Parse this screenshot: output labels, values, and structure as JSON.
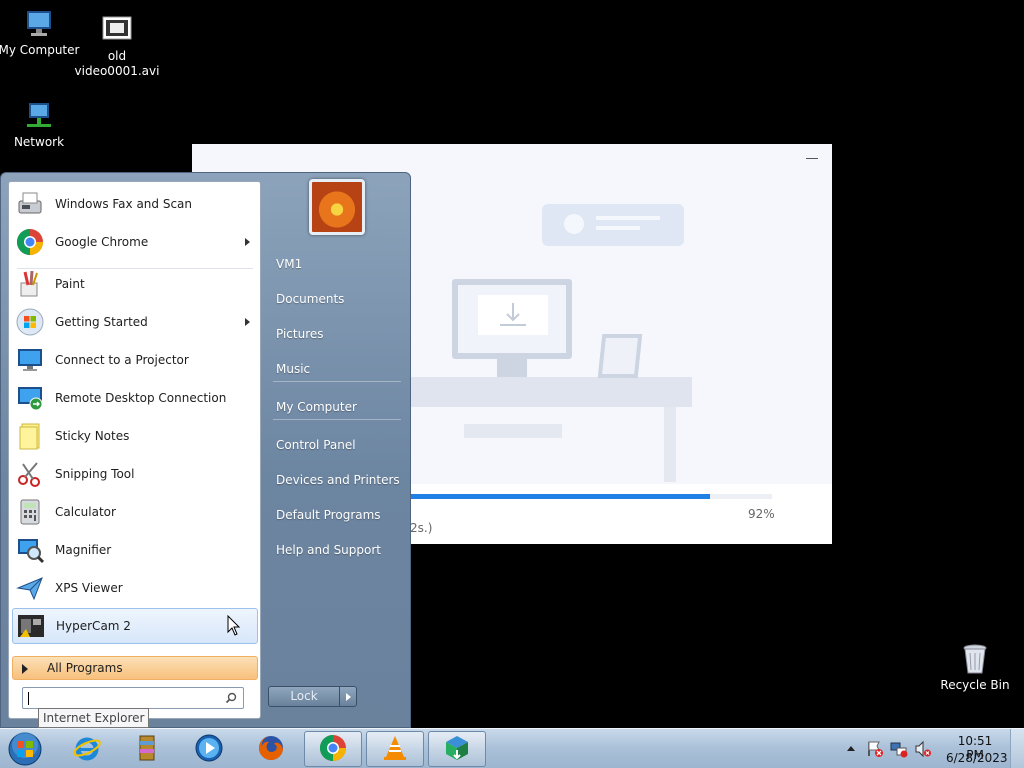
{
  "desktop": {
    "icons": [
      {
        "label": "My Computer"
      },
      {
        "label": "old video0001.avi"
      },
      {
        "label": "Network"
      },
      {
        "label": "Recycle Bin"
      }
    ]
  },
  "installer": {
    "progress_percent": 92,
    "progress_label": "92%",
    "time_label": "2s.)"
  },
  "start_menu": {
    "programs": [
      {
        "label": "Windows Fax and Scan",
        "icon": "fax-scanner-icon",
        "submenu": false
      },
      {
        "label": "Google Chrome",
        "icon": "chrome-icon",
        "submenu": true
      },
      {
        "label": "Paint",
        "icon": "paint-icon",
        "submenu": false
      },
      {
        "label": "Getting Started",
        "icon": "windows-logo-icon",
        "submenu": true
      },
      {
        "label": "Connect to a Projector",
        "icon": "projector-monitor-icon",
        "submenu": false
      },
      {
        "label": "Remote Desktop Connection",
        "icon": "remote-desktop-icon",
        "submenu": false
      },
      {
        "label": "Sticky Notes",
        "icon": "sticky-note-icon",
        "submenu": false
      },
      {
        "label": "Snipping Tool",
        "icon": "scissors-icon",
        "submenu": false
      },
      {
        "label": "Calculator",
        "icon": "calculator-icon",
        "submenu": false
      },
      {
        "label": "Magnifier",
        "icon": "magnifier-icon",
        "submenu": false
      },
      {
        "label": "XPS Viewer",
        "icon": "xps-plane-icon",
        "submenu": false
      },
      {
        "label": "HyperCam 2",
        "icon": "film-camera-icon",
        "submenu": false
      }
    ],
    "all_programs": "All Programs",
    "search_placeholder": "",
    "tooltip": "Internet Explorer",
    "right_items": [
      "VM1",
      "Documents",
      "Pictures",
      "Music",
      "My Computer",
      "Control Panel",
      "Devices and Printers",
      "Default Programs",
      "Help and Support"
    ],
    "lock_label": "Lock"
  },
  "taskbar": {
    "pinned": [
      {
        "icon": "internet-explorer-icon"
      },
      {
        "icon": "winrar-icon"
      },
      {
        "icon": "media-player-icon"
      },
      {
        "icon": "firefox-icon"
      },
      {
        "icon": "chrome-icon"
      },
      {
        "icon": "vlc-icon"
      },
      {
        "icon": "installer-icon"
      }
    ],
    "time": "10:51 PM",
    "date": "6/28/2023"
  },
  "colors": {
    "progress": "#1f80e6",
    "all_programs": "#f8c07c",
    "start_menu": "#7890aa"
  }
}
